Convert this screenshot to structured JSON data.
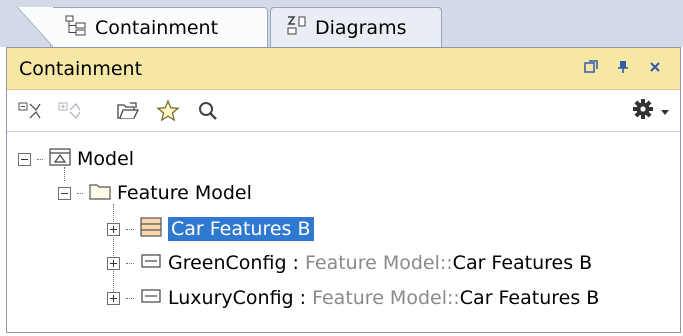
{
  "tabs": [
    {
      "label": "Containment",
      "icon": "containment-tree-icon",
      "active": true
    },
    {
      "label": "Diagrams",
      "icon": "diagrams-tree-icon",
      "active": false
    }
  ],
  "panel": {
    "title": "Containment",
    "controls": [
      "restore-icon",
      "pin-icon",
      "close-icon"
    ]
  },
  "toolbar": {
    "icons": [
      "collapse-all-icon",
      "expand-all-icon",
      "open-folder-icon",
      "favorite-star-icon",
      "search-icon",
      "gear-icon",
      "dropdown-arrow-icon"
    ]
  },
  "tree": {
    "model": {
      "label": "Model"
    },
    "feature_model": {
      "label": "Feature Model"
    },
    "car_features": {
      "label": "Car Features B"
    },
    "green_config": {
      "name": "GreenConfig",
      "sep": " : ",
      "ns": "Feature Model::",
      "type": "Car Features B"
    },
    "luxury_config": {
      "name": "LuxuryConfig",
      "sep": " : ",
      "ns": "Feature Model::",
      "type": "Car Features B"
    }
  },
  "colors": {
    "title_bar": "#f6e7a4",
    "selection": "#3079d1",
    "star": "#f0c419"
  }
}
